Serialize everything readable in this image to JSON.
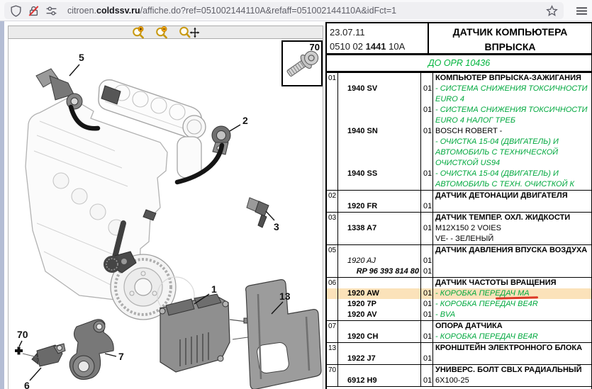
{
  "browser": {
    "url_prefix": "citroen.",
    "url_domain": "coldssv.ru",
    "url_path": "/affiche.do?ref=051002144110A&refaff=051002144110A&idFct=1",
    "icons": [
      "shield-icon",
      "lock-slash-icon",
      "permissions-icon",
      "bookmark-star-icon",
      "menu-icon"
    ]
  },
  "diagram_toolbar": {
    "icons": [
      "zoom-in-icon",
      "zoom-out-icon",
      "zoom-pan-icon"
    ]
  },
  "diagram": {
    "inset_label": "70",
    "callouts": {
      "c1": "1",
      "c2": "2",
      "c3": "3",
      "c5": "5",
      "c6": "6",
      "c7": "7",
      "c13": "13",
      "c70": "70"
    }
  },
  "colors": {
    "green": "#00a83e",
    "opr_green": "#00b43c",
    "highlight": "#fbe2ba",
    "underline": "#dd3826"
  },
  "table": {
    "date": "23.07.11",
    "ref_prefix": "0510 02 ",
    "ref_bold": "1441",
    "ref_suffix": " 10A",
    "title_line1": "ДАТЧИК КОМПЬЮТЕРА",
    "title_line2": "ВПРЫСКА",
    "opr": "ДО OPR 10436",
    "rows": [
      {
        "idx": "01",
        "lines": [
          {
            "desc": "КОМПЬЮТЕР ВПРЫСКА-ЗАЖИГАНИЯ",
            "ds": "bold"
          },
          {
            "part": "1940 SV",
            "ps": "bold",
            "qty": "01",
            "desc": "- СИСТЕМА СНИЖЕНИЯ ТОКСИЧНОСТИ",
            "ds": "green"
          },
          {
            "desc": "EURO 4",
            "ds": "green"
          },
          {
            "qty": "01",
            "desc": "- СИСТЕМА СНИЖЕНИЯ ТОКСИЧНОСТИ",
            "ds": "green"
          },
          {
            "desc": "EURO 4 НАЛОГ ТРЕБ",
            "ds": "green"
          },
          {
            "part": "1940 SN",
            "ps": "bold",
            "qty": "01",
            "desc": "BOSCH ROBERT -"
          },
          {
            "desc": "- ОЧИСТКА 15-04 (ДВИГАТЕЛЬ) И",
            "ds": "green"
          },
          {
            "desc": "АВТОМОБИЛЬ С ТЕХНИЧЕСКОЙ",
            "ds": "green"
          },
          {
            "desc": "ОЧИСТКОЙ US94",
            "ds": "green"
          },
          {
            "part": "1940 SS",
            "ps": "bold",
            "qty": "01",
            "desc": "- ОЧИСТКА 15-04 (ДВИГАТЕЛЬ) И",
            "ds": "green"
          },
          {
            "desc": "АВТОМОБИЛЬ С ТЕХН. ОЧИСТКОЙ К",
            "ds": "green"
          }
        ]
      },
      {
        "idx": "02",
        "lines": [
          {
            "desc": "ДАТЧИК ДЕТОНАЦИИ ДВИГАТЕЛЯ",
            "ds": "bold"
          },
          {
            "part": "1920 FR",
            "ps": "bold",
            "qty": "01"
          }
        ]
      },
      {
        "idx": "03",
        "lines": [
          {
            "desc": "ДАТЧИК ТЕМПЕР. ОХЛ. ЖИДКОСТИ",
            "ds": "bold"
          },
          {
            "part": "1338 A7",
            "ps": "bold",
            "qty": "01",
            "desc": "M12X150 2 VOIES"
          },
          {
            "desc": "VE- - ЗЕЛЕНЫЙ"
          }
        ]
      },
      {
        "idx": "05",
        "lines": [
          {
            "desc": "ДАТЧИК ДАВЛЕНИЯ ВПУСКА ВОЗДУХА",
            "ds": "bold"
          },
          {
            "part": "1920 AJ",
            "ps": "italic",
            "qty": "01"
          },
          {
            "part": "RP 96 393 814 80",
            "ps": "bolditalic-right",
            "qty": "01"
          }
        ]
      },
      {
        "idx": "06",
        "lines": [
          {
            "desc": "ДАТЧИК ЧАСТОТЫ ВРАЩЕНИЯ",
            "ds": "bold"
          },
          {
            "part": "1920 AW",
            "ps": "bold",
            "qty": "01",
            "desc": "- КОРОБКА ПЕРЕДАЧ MA",
            "ds": "green",
            "hl": true,
            "underline": true
          },
          {
            "part": "1920 7P",
            "ps": "bold",
            "qty": "01",
            "desc": "- КОРОБКА ПЕРЕДАЧ BE4R",
            "ds": "green"
          },
          {
            "part": "1920 AV",
            "ps": "bold",
            "qty": "01",
            "desc": "- BVA",
            "ds": "green"
          }
        ]
      },
      {
        "idx": "07",
        "lines": [
          {
            "desc": "ОПОРА ДАТЧИКА",
            "ds": "bold"
          },
          {
            "part": "1920 CH",
            "ps": "bold",
            "qty": "01",
            "desc": "- КОРОБКА ПЕРЕДАЧ BE4R",
            "ds": "green"
          }
        ]
      },
      {
        "idx": "13",
        "lines": [
          {
            "desc": "КРОНШТЕЙН ЭЛЕКТРОННОГО БЛОКА",
            "ds": "bold"
          },
          {
            "part": "1922 J7",
            "ps": "bold",
            "qty": "01"
          }
        ]
      },
      {
        "idx": "70",
        "lines": [
          {
            "desc": "УНИВЕРС. БОЛТ CBLX РАДИАЛЬНЫЙ",
            "ds": "bold"
          },
          {
            "part": "6912 H9",
            "ps": "bold",
            "qty": "01",
            "desc": "6X100-25"
          }
        ]
      }
    ]
  }
}
